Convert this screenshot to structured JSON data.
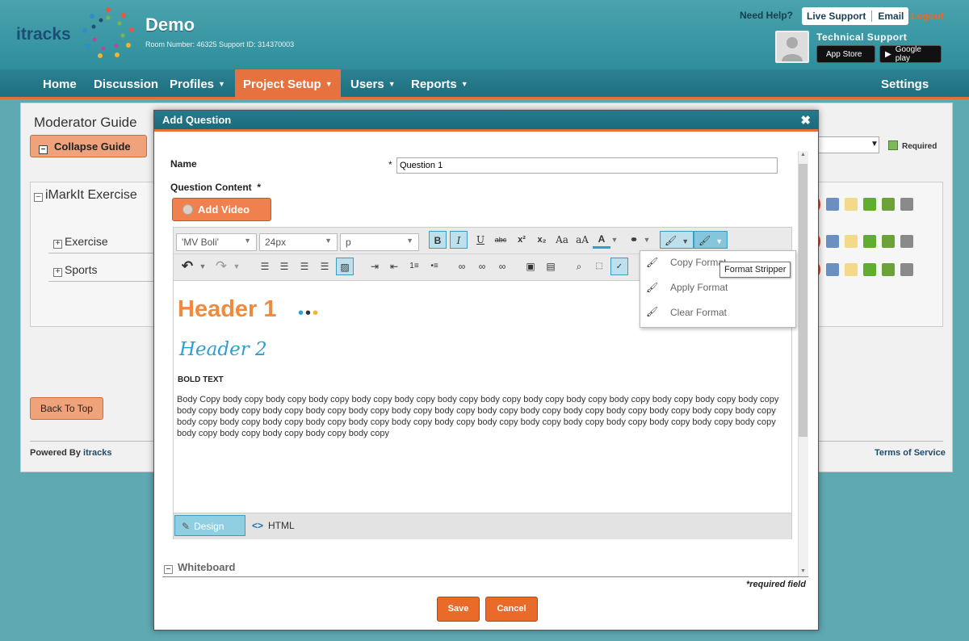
{
  "header": {
    "logo_text": "itracks",
    "title": "Demo",
    "room_info": "Room Number: 46325     Support ID: 314370003",
    "need_help": "Need Help?",
    "live_support": "Live Support",
    "email": "Email",
    "logout": "Logout",
    "tech_support": "Technical Support",
    "app_store": "App Store",
    "google_play": "Google play"
  },
  "nav": {
    "home": "Home",
    "discussion": "Discussion",
    "profiles": "Profiles",
    "project_setup": "Project Setup",
    "users": "Users",
    "reports": "Reports",
    "settings": "Settings",
    "caret": "▼"
  },
  "background": {
    "moderator_guide": "Moderator Guide",
    "collapse_guide": "Collapse Guide",
    "required": "Required",
    "imarkit_exercise": "iMarkIt Exercise",
    "exercise": "Exercise",
    "sports": "Sports",
    "back_to_top": "Back To Top",
    "powered_by": "Powered By",
    "powered_brand": "itracks",
    "terms": "Terms of Service"
  },
  "modal": {
    "title": "Add Question",
    "close": "✖",
    "name_label": "Name",
    "name_star": "*",
    "name_value": "Question 1",
    "content_label": "Question Content",
    "content_star": "*",
    "add_video": "Add Video",
    "whiteboard": "Whiteboard",
    "required_field": "*required field",
    "save": "Save",
    "cancel": "Cancel"
  },
  "editor": {
    "font_family": "'MV Boli'",
    "font_size": "24px",
    "block_format": "p",
    "content": {
      "header1": "Header 1",
      "header2": "Header 2",
      "bold_text": "BOLD TEXT",
      "body": "Body Copy body copy body copy body copy body copy body copy body copy body copy body copy body copy body copy body copy body copy body copy body copy body copy body copy body copy body copy body copy body copy body copy body copy body copy body copy body copy body copy body copy body copy body copy body copy body copy body copy body copy body copy body copy body copy body copy body copy body copy body copy body copy body copy body copy body copy body copy body copy"
    },
    "design_tab": "Design",
    "html_tab": "HTML"
  },
  "format_menu": {
    "items": [
      "Copy Format",
      "Apply Format",
      "Clear Format"
    ],
    "tooltip": "Format Stripper"
  },
  "colors": {
    "accent": "#e6733f",
    "teal": "#2c8191",
    "header1": "#f08a3e",
    "header2": "#2e9ed2"
  }
}
